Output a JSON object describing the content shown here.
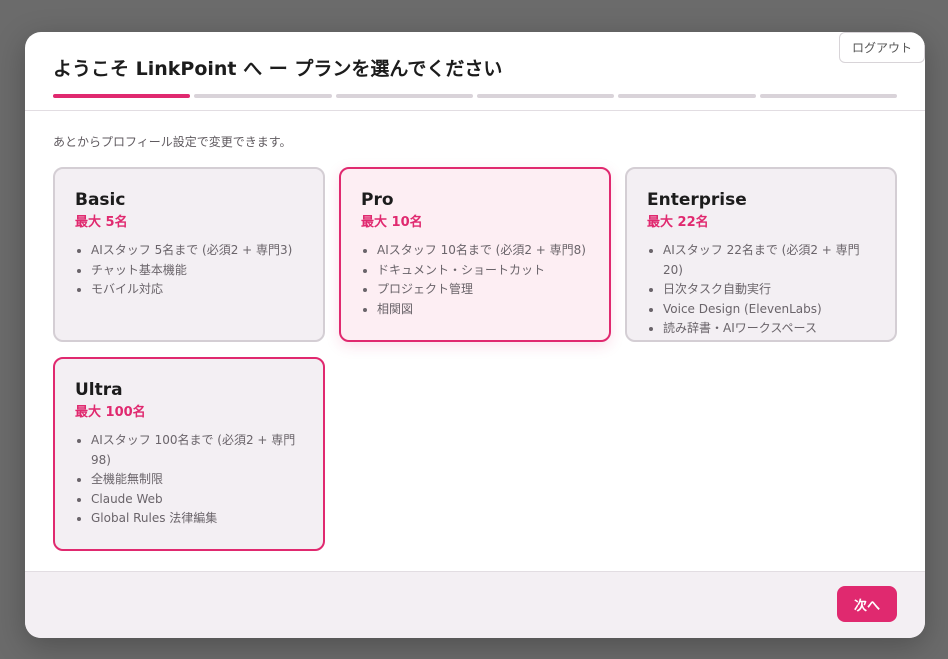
{
  "header": {
    "title": "ようこそ LinkPoint へ ー プランを選んでください",
    "logout_label": "ログアウト",
    "steps_total": 6,
    "current_step": 1
  },
  "main": {
    "subtitle": "あとからプロフィール設定で変更できます。",
    "plans": [
      {
        "name": "Basic",
        "limit": "最大 5名",
        "features": [
          "AIスタッフ 5名まで (必須2 + 専門3)",
          "チャット基本機能",
          "モバイル対応"
        ]
      },
      {
        "name": "Pro",
        "limit": "最大 10名",
        "features": [
          "AIスタッフ 10名まで (必須2 + 専門8)",
          "ドキュメント・ショートカット",
          "プロジェクト管理",
          "相関図"
        ]
      },
      {
        "name": "Enterprise",
        "limit": "最大 22名",
        "features": [
          "AIスタッフ 22名まで (必須2 + 専門20)",
          "日次タスク自動実行",
          "Voice Design (ElevenLabs)",
          "読み辞書・AIワークスペース"
        ]
      },
      {
        "name": "Ultra",
        "limit": "最大 100名",
        "features": [
          "AIスタッフ 100名まで (必須2 + 専門98)",
          "全機能無制限",
          "Claude Web",
          "Global Rules 法律編集"
        ]
      }
    ]
  },
  "footer": {
    "next_label": "次へ"
  },
  "colors": {
    "accent": "#e0296f",
    "card_bg": "#f3eff3",
    "selected_bg": "#fdeef3"
  }
}
